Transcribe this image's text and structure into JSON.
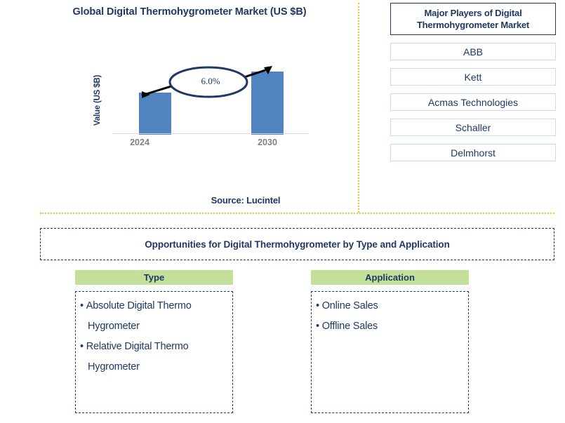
{
  "chart_panel": {
    "title": "Global Digital Thermohygrometer Market (US $B)",
    "y_axis_label": "Value (US $B)",
    "source": "Source: Lucintel"
  },
  "chart_data": {
    "type": "bar",
    "title": "Global Digital Thermohygrometer Market (US $B)",
    "categories": [
      "2024",
      "2030"
    ],
    "values": [
      60,
      90
    ],
    "xlabel": "",
    "ylabel": "Value (US $B)",
    "ylim": [
      0,
      100
    ],
    "grid": false,
    "legend": "none",
    "bar_color": "#5183be",
    "annotations": [
      {
        "label": "6.0%",
        "type": "cagr-ellipse-arrow",
        "from_category": "2024",
        "to_category": "2030"
      }
    ],
    "tick_label_color": "#808080",
    "axis_line_color": "#d9d9d9"
  },
  "players": {
    "header": "Major Players of Digital Thermohygrometer Market",
    "items": [
      {
        "name": "ABB"
      },
      {
        "name": "Kett"
      },
      {
        "name": "Acmas Technologies"
      },
      {
        "name": "Schaller"
      },
      {
        "name": "Delmhorst"
      }
    ]
  },
  "opportunities": {
    "title": "Opportunities for Digital Thermohygrometer by Type and Application"
  },
  "segments": [
    {
      "header": "Type",
      "items": [
        "Absolute Digital Thermo Hygrometer",
        "Relative Digital Thermo Hygrometer"
      ]
    },
    {
      "header": "Application",
      "items": [
        "Online Sales",
        "Offline Sales"
      ]
    }
  ],
  "colors": {
    "navy": "#1f3864",
    "bar_blue": "#5183be",
    "divider_gold": "#f5bc2b",
    "segment_header_green": "#c3e09a",
    "player_border_blue": "#c9dcf0"
  }
}
